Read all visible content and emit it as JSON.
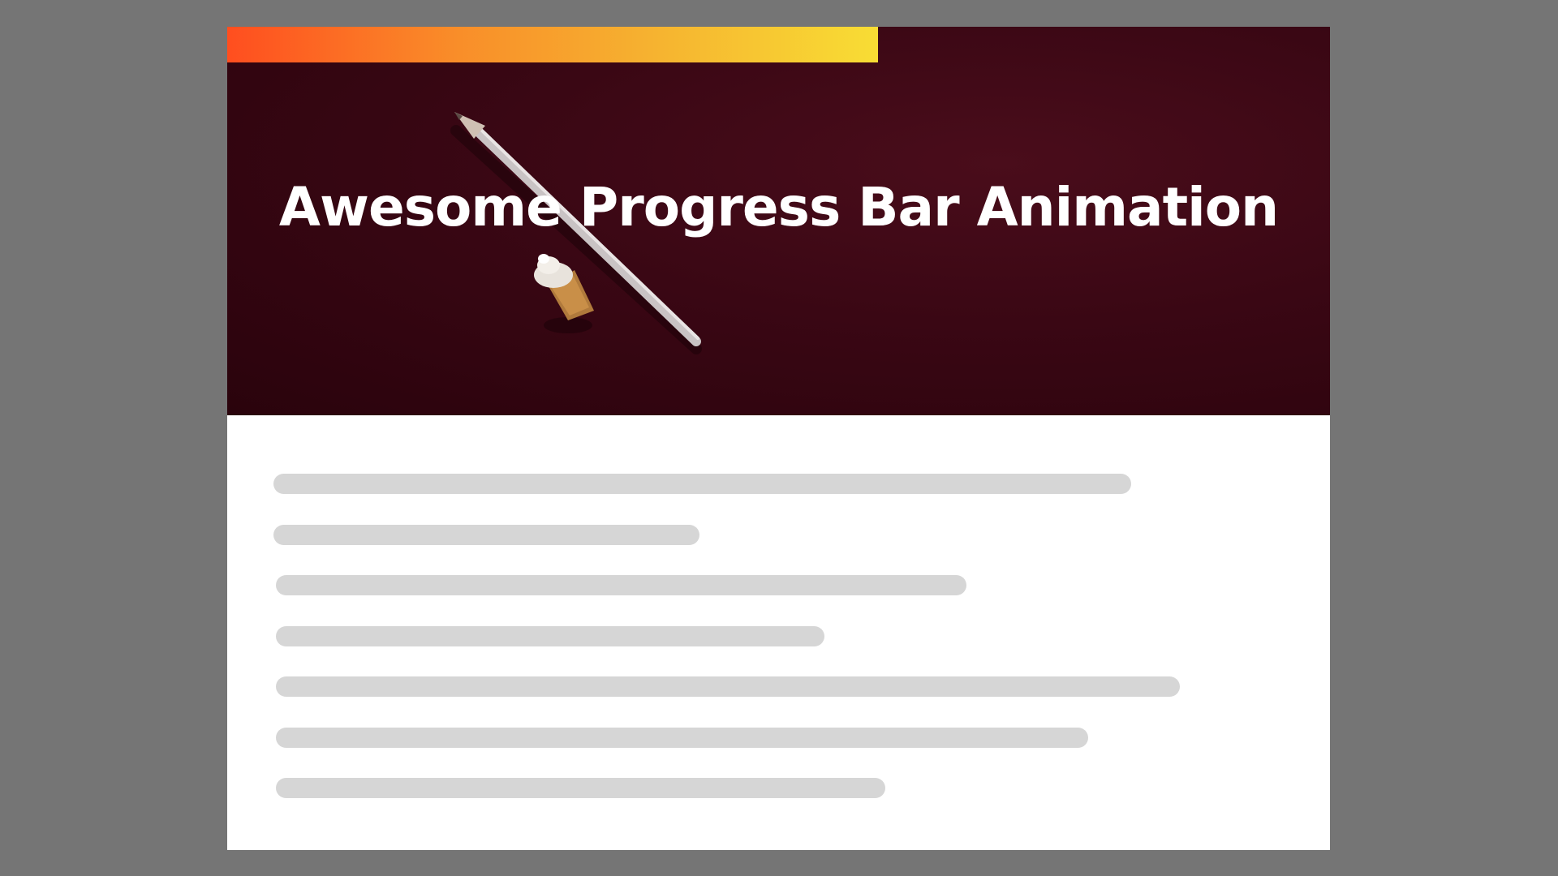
{
  "hero": {
    "title": "Awesome Progress Bar Animation"
  },
  "progress": {
    "fraction": 0.59,
    "colors": [
      "#ff4e1f",
      "#f98d29",
      "#f6b230",
      "#f8dd34"
    ]
  },
  "colors": {
    "page_background": "#757575",
    "hero_background": "#3a0714",
    "skeleton": "#d6d6d6",
    "card": "#ffffff"
  },
  "content": {
    "placeholder_line_count": 7
  }
}
